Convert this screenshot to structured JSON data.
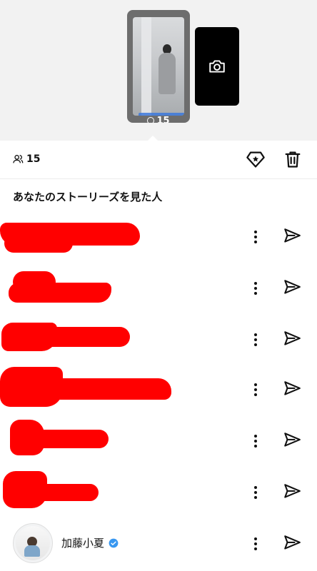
{
  "preview": {
    "story_view_count": "15",
    "camera_label": "camera-icon"
  },
  "stats": {
    "viewer_count": "15",
    "icons": [
      "people-icon",
      "promote-diamond-icon",
      "trash-icon"
    ]
  },
  "viewers_section": {
    "title": "あなたのストーリーズを見た人"
  },
  "viewers": [
    {
      "name": "",
      "redacted": true
    },
    {
      "name": "",
      "redacted": true
    },
    {
      "name": "",
      "redacted": true
    },
    {
      "name": "",
      "redacted": true
    },
    {
      "name": "",
      "redacted": true
    },
    {
      "name": "",
      "redacted": true
    },
    {
      "name": "加藤小夏",
      "redacted": false,
      "verified": true
    }
  ],
  "colors": {
    "redaction": "#ff0000",
    "verified": "#3897f0",
    "strip_bg": "#f2f2f2"
  }
}
